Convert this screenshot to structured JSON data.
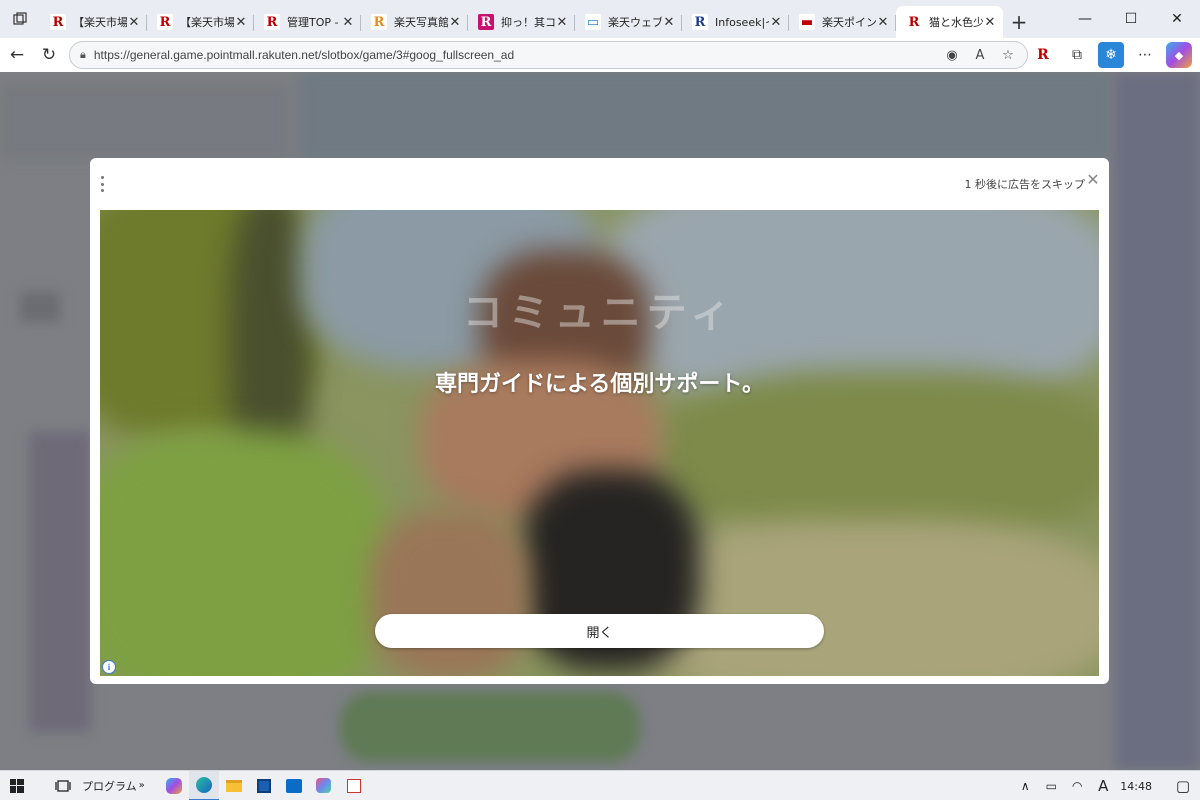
{
  "browser": {
    "tabs": [
      {
        "title": "【楽天市場】",
        "favicon": "R",
        "favicon_color": "#bf0000",
        "favicon_bg": "#ffffff"
      },
      {
        "title": "【楽天市場】",
        "favicon": "R",
        "favicon_color": "#bf0000",
        "favicon_bg": "#ffffff"
      },
      {
        "title": "管理TOP - 楽",
        "favicon": "R",
        "favicon_color": "#bf0000",
        "favicon_bg": "#ffffff"
      },
      {
        "title": "楽天写真館",
        "favicon": "R",
        "favicon_color": "#e88a1a",
        "favicon_bg": "#ffffff"
      },
      {
        "title": "抑っ！其コレ",
        "favicon": "R",
        "favicon_color": "#ffffff",
        "favicon_bg": "#c8106e"
      },
      {
        "title": "楽天ウェブ検",
        "favicon": "▭",
        "favicon_color": "#2a8bd6",
        "favicon_bg": "#ffffff"
      },
      {
        "title": "Infoseek|イ",
        "favicon": "R",
        "favicon_color": "#1c3f8c",
        "favicon_bg": "#ffffff"
      },
      {
        "title": "楽天ポイント",
        "favicon": "▬",
        "favicon_color": "#bf0000",
        "favicon_bg": "#ffffff"
      },
      {
        "title": "猫と水色少女",
        "favicon": "R",
        "favicon_color": "#bf0000",
        "favicon_bg": "#ffffff",
        "active": true
      }
    ],
    "url": "https://general.game.pointmall.rakuten.net/slotbox/game/3#goog_fullscreen_ad"
  },
  "ad": {
    "skip_text": "1 秒後に広告をスキップ",
    "faint_text": "コミュニティ",
    "headline": "専門ガイドによる個別サポート。",
    "cta": "開く",
    "info": "i"
  },
  "taskbar": {
    "program_label": "プログラム",
    "time": "14:48",
    "ime": "A"
  }
}
